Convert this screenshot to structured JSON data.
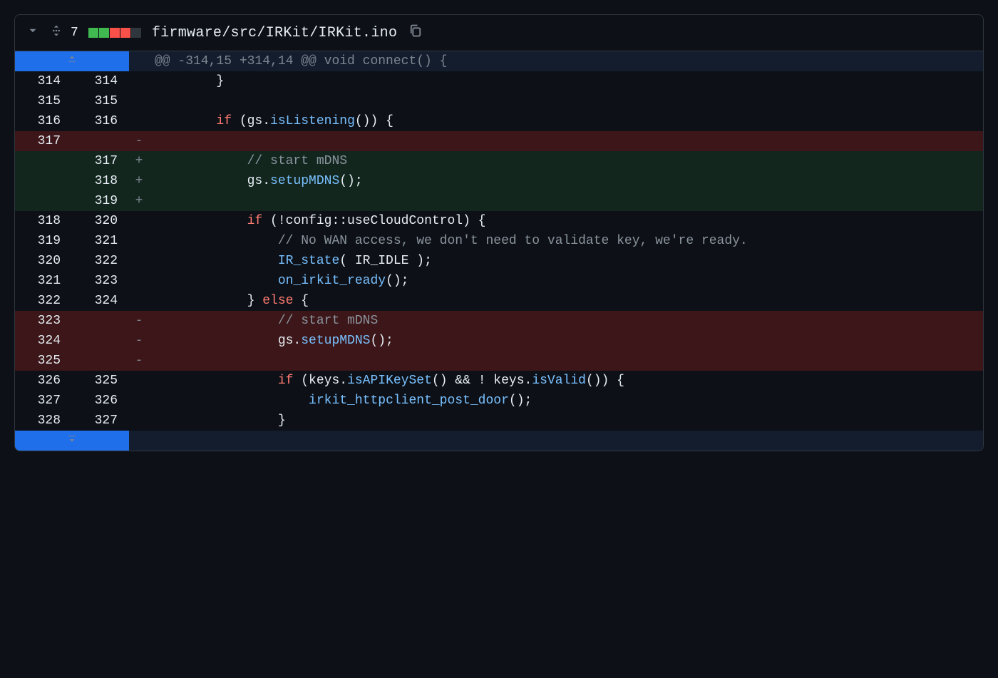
{
  "header": {
    "changed_lines": "7",
    "squares": [
      "add",
      "add",
      "del",
      "del",
      "neu"
    ],
    "path": "firmware/src/IRKit/IRKit.ino"
  },
  "hunk_header": "@@ -314,15 +314,14 @@ void connect() {",
  "rows": [
    {
      "type": "ctx",
      "lnL": "314",
      "lnR": "314",
      "marker": "",
      "tokens": [
        {
          "c": "pl",
          "t": "        }"
        }
      ]
    },
    {
      "type": "ctx",
      "lnL": "315",
      "lnR": "315",
      "marker": "",
      "tokens": [
        {
          "c": "pl",
          "t": ""
        }
      ]
    },
    {
      "type": "ctx",
      "lnL": "316",
      "lnR": "316",
      "marker": "",
      "tokens": [
        {
          "c": "pl",
          "t": "        "
        },
        {
          "c": "k",
          "t": "if"
        },
        {
          "c": "pl",
          "t": " (gs."
        },
        {
          "c": "fn",
          "t": "isListening"
        },
        {
          "c": "pl",
          "t": "()) {"
        }
      ]
    },
    {
      "type": "del",
      "lnL": "317",
      "lnR": "",
      "marker": "-",
      "tokens": [
        {
          "c": "pl",
          "t": ""
        }
      ]
    },
    {
      "type": "add",
      "lnL": "",
      "lnR": "317",
      "marker": "+",
      "tokens": [
        {
          "c": "pl",
          "t": "            "
        },
        {
          "c": "cm",
          "t": "// start mDNS"
        }
      ]
    },
    {
      "type": "add",
      "lnL": "",
      "lnR": "318",
      "marker": "+",
      "tokens": [
        {
          "c": "pl",
          "t": "            gs."
        },
        {
          "c": "fn",
          "t": "setupMDNS"
        },
        {
          "c": "pl",
          "t": "();"
        }
      ]
    },
    {
      "type": "add",
      "lnL": "",
      "lnR": "319",
      "marker": "+",
      "tokens": [
        {
          "c": "pl",
          "t": ""
        }
      ]
    },
    {
      "type": "ctx",
      "lnL": "318",
      "lnR": "320",
      "marker": "",
      "tokens": [
        {
          "c": "pl",
          "t": "            "
        },
        {
          "c": "k",
          "t": "if"
        },
        {
          "c": "pl",
          "t": " (!config::useCloudControl) {"
        }
      ]
    },
    {
      "type": "ctx",
      "lnL": "319",
      "lnR": "321",
      "marker": "",
      "tokens": [
        {
          "c": "pl",
          "t": "                "
        },
        {
          "c": "cm",
          "t": "// No WAN access, we don't need to validate key, we're ready."
        }
      ]
    },
    {
      "type": "ctx",
      "lnL": "320",
      "lnR": "322",
      "marker": "",
      "tokens": [
        {
          "c": "pl",
          "t": "                "
        },
        {
          "c": "fn",
          "t": "IR_state"
        },
        {
          "c": "pl",
          "t": "( IR_IDLE );"
        }
      ]
    },
    {
      "type": "ctx",
      "lnL": "321",
      "lnR": "323",
      "marker": "",
      "tokens": [
        {
          "c": "pl",
          "t": "                "
        },
        {
          "c": "fn",
          "t": "on_irkit_ready"
        },
        {
          "c": "pl",
          "t": "();"
        }
      ]
    },
    {
      "type": "ctx",
      "lnL": "322",
      "lnR": "324",
      "marker": "",
      "tokens": [
        {
          "c": "pl",
          "t": "            } "
        },
        {
          "c": "k",
          "t": "else"
        },
        {
          "c": "pl",
          "t": " {"
        }
      ]
    },
    {
      "type": "del",
      "lnL": "323",
      "lnR": "",
      "marker": "-",
      "tokens": [
        {
          "c": "pl",
          "t": "                "
        },
        {
          "c": "cm",
          "t": "// start mDNS"
        }
      ]
    },
    {
      "type": "del",
      "lnL": "324",
      "lnR": "",
      "marker": "-",
      "tokens": [
        {
          "c": "pl",
          "t": "                gs."
        },
        {
          "c": "fn",
          "t": "setupMDNS"
        },
        {
          "c": "pl",
          "t": "();"
        }
      ]
    },
    {
      "type": "del",
      "lnL": "325",
      "lnR": "",
      "marker": "-",
      "tokens": [
        {
          "c": "pl",
          "t": ""
        }
      ]
    },
    {
      "type": "ctx",
      "lnL": "326",
      "lnR": "325",
      "marker": "",
      "tokens": [
        {
          "c": "pl",
          "t": "                "
        },
        {
          "c": "k",
          "t": "if"
        },
        {
          "c": "pl",
          "t": " (keys."
        },
        {
          "c": "fn",
          "t": "isAPIKeySet"
        },
        {
          "c": "pl",
          "t": "() && ! keys."
        },
        {
          "c": "fn",
          "t": "isValid"
        },
        {
          "c": "pl",
          "t": "()) {"
        }
      ]
    },
    {
      "type": "ctx",
      "lnL": "327",
      "lnR": "326",
      "marker": "",
      "tokens": [
        {
          "c": "pl",
          "t": "                    "
        },
        {
          "c": "fn",
          "t": "irkit_httpclient_post_door"
        },
        {
          "c": "pl",
          "t": "();"
        }
      ]
    },
    {
      "type": "ctx",
      "lnL": "328",
      "lnR": "327",
      "marker": "",
      "tokens": [
        {
          "c": "pl",
          "t": "                }"
        }
      ]
    }
  ]
}
